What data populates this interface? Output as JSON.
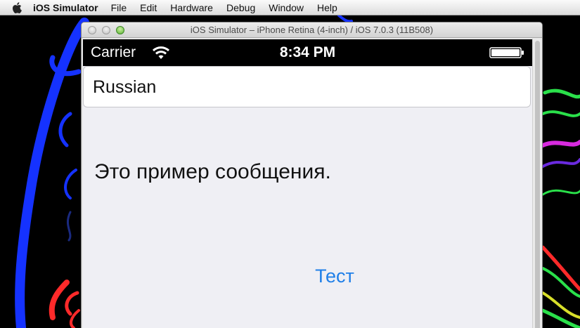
{
  "menubar": {
    "app_name": "iOS Simulator",
    "items": [
      "File",
      "Edit",
      "Hardware",
      "Debug",
      "Window",
      "Help"
    ]
  },
  "window": {
    "title": "iOS Simulator – iPhone Retina (4-inch) / iOS 7.0.3 (11B508)"
  },
  "statusbar": {
    "carrier": "Carrier",
    "time": "8:34 PM"
  },
  "app": {
    "language_field_value": "Russian",
    "message_text": "Это пример сообщения.",
    "test_button_label": "Тест",
    "accent_color": "#1f7fe8"
  }
}
